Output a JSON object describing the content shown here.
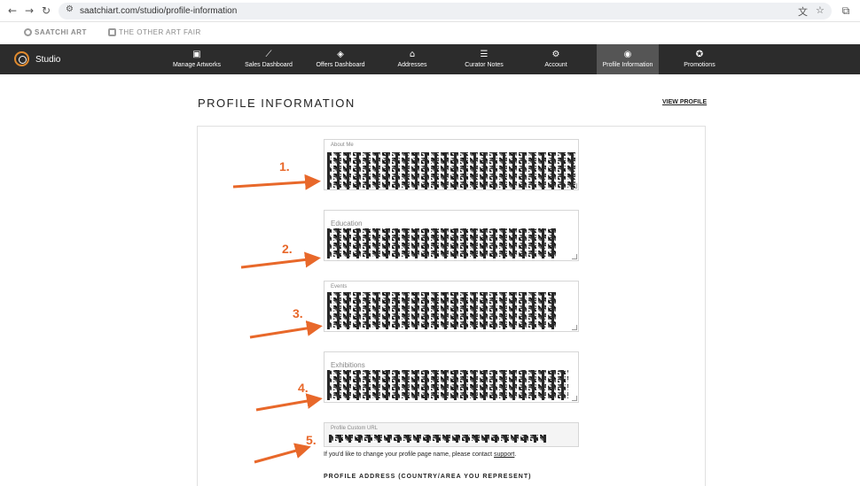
{
  "browser": {
    "back_icon": "back-arrow-icon",
    "forward_icon": "forward-arrow-icon",
    "reload_icon": "reload-icon",
    "url": "saatchiart.com/studio/profile-information"
  },
  "brands": {
    "saatchi": "SAATCHI ART",
    "other_art_fair": "THE OTHER ART FAIR"
  },
  "studio": {
    "label": "Studio",
    "nav": [
      {
        "label": "Manage Artworks",
        "icon": "image-icon",
        "glyph": "▣"
      },
      {
        "label": "Sales Dashboard",
        "icon": "chart-icon",
        "glyph": "⟋"
      },
      {
        "label": "Offers Dashboard",
        "icon": "tag-icon",
        "glyph": "◈"
      },
      {
        "label": "Addresses",
        "icon": "home-icon",
        "glyph": "⌂"
      },
      {
        "label": "Curator Notes",
        "icon": "notes-icon",
        "glyph": "☰"
      },
      {
        "label": "Account",
        "icon": "gear-icon",
        "glyph": "⚙"
      },
      {
        "label": "Profile Information",
        "icon": "user-icon",
        "glyph": "◉"
      },
      {
        "label": "Promotions",
        "icon": "rocket-icon",
        "glyph": "✪"
      }
    ],
    "active_index": 6
  },
  "page": {
    "title": "PROFILE INFORMATION",
    "view_profile": "VIEW PROFILE"
  },
  "form": {
    "about_me_label": "About Me",
    "education_label": "Education",
    "events_label": "Events",
    "exhibitions_label": "Exhibitions",
    "custom_url_label": "Profile Custom URL",
    "hint_text": "If you'd like to change your profile page name, please contact ",
    "hint_link": "support",
    "hint_end": ".",
    "address_heading": "PROFILE ADDRESS (COUNTRY/AREA YOU REPRESENT)"
  },
  "annotations": {
    "n1": "1.",
    "n2": "2.",
    "n3": "3.",
    "n4": "4.",
    "n5": "5.",
    "color": "#e8682a"
  }
}
